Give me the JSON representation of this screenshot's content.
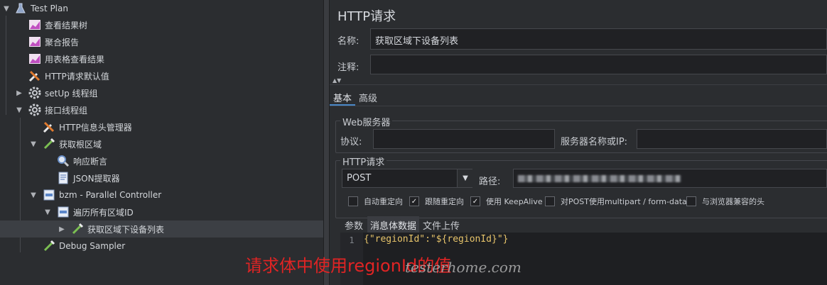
{
  "tree": {
    "items": [
      {
        "label": "Test Plan",
        "icon": "flask-icon"
      },
      {
        "label": "查看结果树",
        "icon": "graph-icon"
      },
      {
        "label": "聚合报告",
        "icon": "graph-icon"
      },
      {
        "label": "用表格查看结果",
        "icon": "graph-icon"
      },
      {
        "label": "HTTP请求默认值",
        "icon": "wrench-icon"
      },
      {
        "label": "setUp 线程组",
        "icon": "gear-icon"
      },
      {
        "label": "接口线程组",
        "icon": "gear-icon"
      },
      {
        "label": "HTTP信息头管理器",
        "icon": "wrench-icon"
      },
      {
        "label": "获取根区域",
        "icon": "pipette-icon"
      },
      {
        "label": "响应断言",
        "icon": "magnifier-icon"
      },
      {
        "label": "JSON提取器",
        "icon": "extractor-icon"
      },
      {
        "label": "bzm - Parallel Controller",
        "icon": "controller-icon"
      },
      {
        "label": "遍历所有区域ID",
        "icon": "controller-icon"
      },
      {
        "label": "获取区域下设备列表",
        "icon": "pipette-icon"
      },
      {
        "label": "Debug Sampler",
        "icon": "pipette-icon"
      }
    ]
  },
  "panel": {
    "title": "HTTP请求",
    "name_label": "名称:",
    "name_value": "获取区域下设备列表",
    "comment_label": "注释:",
    "comment_value": "",
    "tabs": [
      "基本",
      "高级"
    ],
    "web_server_group": "Web服务器",
    "protocol_label": "协议:",
    "protocol_value": "",
    "server_label": "服务器名称或IP:",
    "server_value": "",
    "http_request_group": "HTTP请求",
    "method_value": "POST",
    "path_label": "路径:",
    "options": [
      {
        "label": "自动重定向",
        "checked": false
      },
      {
        "label": "跟随重定向",
        "checked": true
      },
      {
        "label": "使用 KeepAlive",
        "checked": true
      },
      {
        "label": "对POST使用multipart / form-data",
        "checked": false
      },
      {
        "label": "与浏览器兼容的头",
        "checked": false
      }
    ],
    "body_tabs": [
      "参数",
      "消息体数据",
      "文件上传"
    ],
    "line_number": "1",
    "body_code": "{\"regionId\":\"${regionId}\"}"
  },
  "annotation": "请求体中使用regionId的值",
  "watermark": "testerhome.com"
}
